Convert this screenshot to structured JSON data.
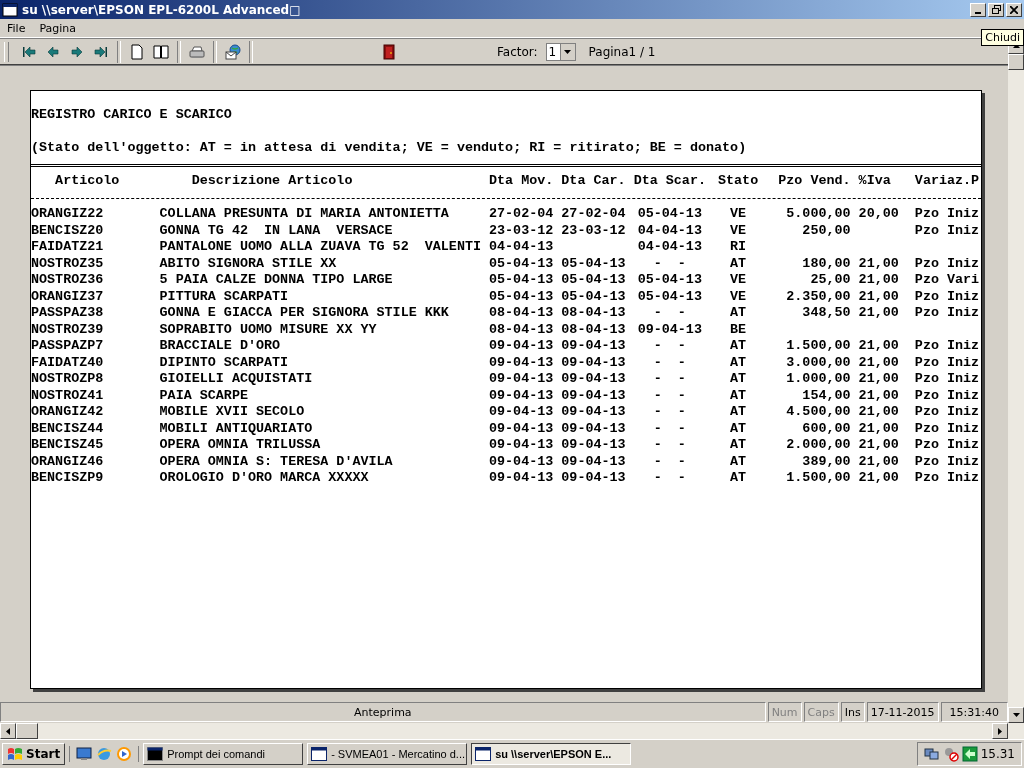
{
  "window": {
    "title": "su \\\\server\\EPSON EPL-6200L Advanced□",
    "tooltip": "Chiudi"
  },
  "menu": [
    "File",
    "Pagina"
  ],
  "toolbar": {
    "factor_label": "Factor:",
    "factor_value": "1",
    "page_label": "Pagina1 / 1"
  },
  "report": {
    "title": "REGISTRO CARICO E SCARICO",
    "legend": "(Stato dell'oggetto: AT = in attesa di vendita; VE = venduto; RI = ritirato; BE = donato)",
    "columns": [
      "Articolo",
      "Descrizione Articolo",
      "Dta Mov.",
      "Dta Car.",
      "Dta Scar.",
      "Stato",
      "Pzo Vend.",
      "%Iva",
      "Variaz.P"
    ],
    "rows": [
      {
        "articolo": "ORANGIZ22",
        "descrizione": "COLLANA PRESUNTA DI MARIA ANTONIETTA",
        "dta_mov": "27-02-04",
        "dta_car": "27-02-04",
        "dta_scar": "05-04-13",
        "stato": "VE",
        "pzo_vend": "5.000,00",
        "iva": "20,00",
        "variaz": "Pzo Iniz"
      },
      {
        "articolo": "BENCISZ20",
        "descrizione": "GONNA TG 42  IN LANA  VERSACE",
        "dta_mov": "23-03-12",
        "dta_car": "23-03-12",
        "dta_scar": "04-04-13",
        "stato": "VE",
        "pzo_vend": "250,00",
        "variaz": "Pzo Iniz"
      },
      {
        "articolo": "FAIDATZ21",
        "descrizione": "PANTALONE UOMO ALLA ZUAVA TG 52  VALENTI",
        "dta_mov": "04-04-13",
        "dta_scar": "04-04-13",
        "stato": "RI"
      },
      {
        "articolo": "NOSTROZ35",
        "descrizione": "ABITO SIGNORA STILE XX",
        "dta_mov": "05-04-13",
        "dta_car": "05-04-13",
        "dta_scar": "-  -",
        "stato": "AT",
        "pzo_vend": "180,00",
        "iva": "21,00",
        "variaz": "Pzo Iniz"
      },
      {
        "articolo": "NOSTROZ36",
        "descrizione": "5 PAIA CALZE DONNA TIPO LARGE",
        "dta_mov": "05-04-13",
        "dta_car": "05-04-13",
        "dta_scar": "05-04-13",
        "stato": "VE",
        "pzo_vend": "25,00",
        "iva": "21,00",
        "variaz": "Pzo Vari"
      },
      {
        "articolo": "ORANGIZ37",
        "descrizione": "PITTURA SCARPATI",
        "dta_mov": "05-04-13",
        "dta_car": "05-04-13",
        "dta_scar": "05-04-13",
        "stato": "VE",
        "pzo_vend": "2.350,00",
        "iva": "21,00",
        "variaz": "Pzo Iniz"
      },
      {
        "articolo": "PASSPAZ38",
        "descrizione": "GONNA E GIACCA PER SIGNORA STILE KKK",
        "dta_mov": "08-04-13",
        "dta_car": "08-04-13",
        "dta_scar": "-  -",
        "stato": "AT",
        "pzo_vend": "348,50",
        "iva": "21,00",
        "variaz": "Pzo Iniz"
      },
      {
        "articolo": "NOSTROZ39",
        "descrizione": "SOPRABITO UOMO MISURE XX YY",
        "dta_mov": "08-04-13",
        "dta_car": "08-04-13",
        "dta_scar": "09-04-13",
        "stato": "BE"
      },
      {
        "articolo": "PASSPAZP7",
        "descrizione": "BRACCIALE D'ORO",
        "dta_mov": "09-04-13",
        "dta_car": "09-04-13",
        "dta_scar": "-  -",
        "stato": "AT",
        "pzo_vend": "1.500,00",
        "iva": "21,00",
        "variaz": "Pzo Iniz"
      },
      {
        "articolo": "FAIDATZ40",
        "descrizione": "DIPINTO SCARPATI",
        "dta_mov": "09-04-13",
        "dta_car": "09-04-13",
        "dta_scar": "-  -",
        "stato": "AT",
        "pzo_vend": "3.000,00",
        "iva": "21,00",
        "variaz": "Pzo Iniz"
      },
      {
        "articolo": "NOSTROZP8",
        "descrizione": "GIOIELLI ACQUISTATI",
        "dta_mov": "09-04-13",
        "dta_car": "09-04-13",
        "dta_scar": "-  -",
        "stato": "AT",
        "pzo_vend": "1.000,00",
        "iva": "21,00",
        "variaz": "Pzo Iniz"
      },
      {
        "articolo": "NOSTROZ41",
        "descrizione": "PAIA SCARPE",
        "dta_mov": "09-04-13",
        "dta_car": "09-04-13",
        "dta_scar": "-  -",
        "stato": "AT",
        "pzo_vend": "154,00",
        "iva": "21,00",
        "variaz": "Pzo Iniz"
      },
      {
        "articolo": "ORANGIZ42",
        "descrizione": "MOBILE XVII SECOLO",
        "dta_mov": "09-04-13",
        "dta_car": "09-04-13",
        "dta_scar": "-  -",
        "stato": "AT",
        "pzo_vend": "4.500,00",
        "iva": "21,00",
        "variaz": "Pzo Iniz"
      },
      {
        "articolo": "BENCISZ44",
        "descrizione": "MOBILI ANTIQUARIATO",
        "dta_mov": "09-04-13",
        "dta_car": "09-04-13",
        "dta_scar": "-  -",
        "stato": "AT",
        "pzo_vend": "600,00",
        "iva": "21,00",
        "variaz": "Pzo Iniz"
      },
      {
        "articolo": "BENCISZ45",
        "descrizione": "OPERA OMNIA TRILUSSA",
        "dta_mov": "09-04-13",
        "dta_car": "09-04-13",
        "dta_scar": "-  -",
        "stato": "AT",
        "pzo_vend": "2.000,00",
        "iva": "21,00",
        "variaz": "Pzo Iniz"
      },
      {
        "articolo": "ORANGIZ46",
        "descrizione": "OPERA OMNIA S: TERESA D'AVILA",
        "dta_mov": "09-04-13",
        "dta_car": "09-04-13",
        "dta_scar": "-  -",
        "stato": "AT",
        "pzo_vend": "389,00",
        "iva": "21,00",
        "variaz": "Pzo Iniz"
      },
      {
        "articolo": "BENCISZP9",
        "descrizione": "OROLOGIO D'ORO MARCA XXXXX",
        "dta_mov": "09-04-13",
        "dta_car": "09-04-13",
        "dta_scar": "-  -",
        "stato": "AT",
        "pzo_vend": "1.500,00",
        "iva": "21,00",
        "variaz": "Pzo Iniz"
      }
    ]
  },
  "status_bar": {
    "message": "Anteprima",
    "indicators": [
      {
        "label": "Num",
        "disabled": true
      },
      {
        "label": "Caps",
        "disabled": true
      },
      {
        "label": "Ins",
        "disabled": false
      }
    ],
    "date": "17-11-2015",
    "time": "15:31:40"
  },
  "taskbar": {
    "start": "Start",
    "tasks": [
      {
        "label": "Prompt dei comandi",
        "kind": "console",
        "selected": false
      },
      {
        "label": "- SVMEA01 - Mercatino d...",
        "kind": "window",
        "selected": false
      },
      {
        "label": "su \\\\server\\EPSON E...",
        "kind": "window",
        "selected": true
      }
    ],
    "clock": "15.31"
  }
}
